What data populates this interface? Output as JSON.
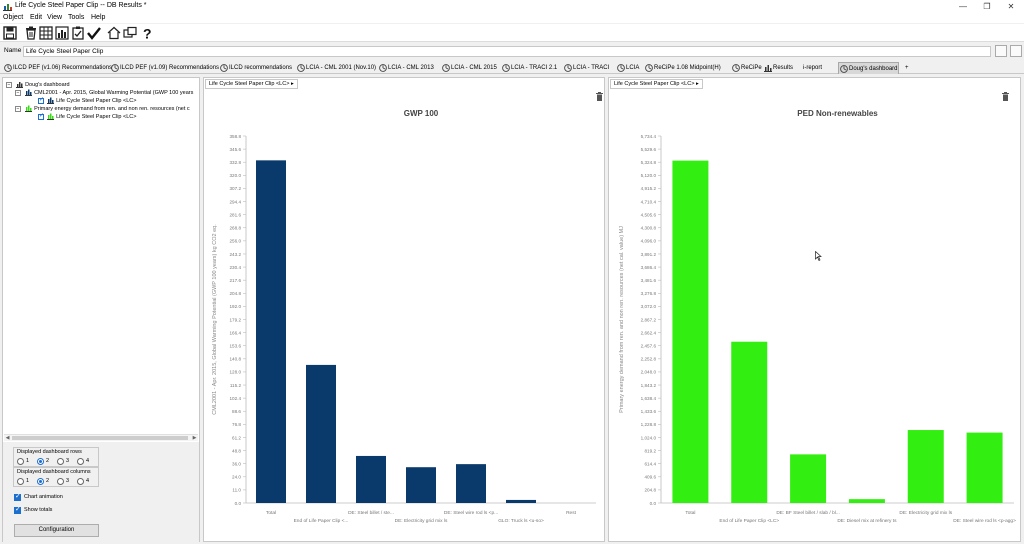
{
  "window": {
    "title": "Life Cycle Steel Paper Clip -- DB Results *",
    "controls": [
      "—",
      "❐",
      "✕"
    ]
  },
  "menu": [
    "Object",
    "Edit",
    "View",
    "Tools",
    "Help"
  ],
  "toolbar": {
    "icons": [
      "save-icon",
      "delete-icon",
      "table-icon",
      "bar-chart-icon",
      "checklist-icon",
      "check-icon",
      "home-icon",
      "windows-icon",
      "help-icon"
    ]
  },
  "namebar": {
    "label": "Name",
    "value": "Life Cycle Steel Paper Clip"
  },
  "tabs": [
    {
      "label": "ILCD PEF (v1.06) Recommendations",
      "icon": "chart"
    },
    {
      "label": "ILCD PEF (v1.09) Recommendations",
      "icon": "chart"
    },
    {
      "label": "ILCD recommendations",
      "icon": "chart"
    },
    {
      "label": "LCIA - CML 2001 (Nov.10)",
      "icon": "chart"
    },
    {
      "label": "LCIA - CML 2013",
      "icon": "chart"
    },
    {
      "label": "LCIA - CML 2015",
      "icon": "chart"
    },
    {
      "label": "LCIA - TRACI 2.1",
      "icon": "chart"
    },
    {
      "label": "LCIA - TRACI",
      "icon": "chart"
    },
    {
      "label": "LCIA",
      "icon": "chart"
    },
    {
      "label": "ReCiPe 1.08 Midpoint(H)",
      "icon": "chart"
    },
    {
      "label": "ReCiPe",
      "icon": "chart"
    },
    {
      "label": "Results",
      "icon": "results"
    },
    {
      "label": "i-report",
      "icon": "none"
    },
    {
      "label": "Doug's dashboard",
      "icon": "dash"
    },
    {
      "label": "+",
      "icon": "none"
    }
  ],
  "tree": {
    "root": "Doug's dashboard",
    "items": [
      {
        "label": "CML2001 - Apr. 2015, Global Warming Potential (GWP 100 years",
        "child": "Life Cycle Steel Paper Clip <LC>",
        "color": "#0a3a6b"
      },
      {
        "label": "Primary energy demand from ren. and non ren. resources (net c",
        "child": "Life Cycle Steel Paper Clip <LC>",
        "color": "#33dd11"
      }
    ]
  },
  "settings": {
    "rows_label": "Displayed dashboard rows",
    "cols_label": "Displayed dashboard columns",
    "options": [
      "1",
      "2",
      "3",
      "4"
    ],
    "rows_selected": 2,
    "cols_selected": 2,
    "chart_animation": "Chart animation",
    "show_totals": "Show totals",
    "config_button": "Configuration"
  },
  "panels": [
    {
      "selector": "Life Cycle Steel Paper Clip <LC>"
    },
    {
      "selector": "Life Cycle Steel Paper Clip <LC>"
    }
  ],
  "colors": {
    "gwp_bar": "#0a3a6b",
    "ped_bar": "#33ee11"
  },
  "chart_data": [
    {
      "type": "bar",
      "title": "GWP 100",
      "ylabel": "CML2001 - Apr. 2015, Global Warming Potential (GWP 100 years) kg CO2 eq.",
      "xlabel": "",
      "ylim": [
        0,
        358.8
      ],
      "yticks": [
        0.0,
        11.0,
        24.0,
        36.0,
        48.8,
        61.2,
        76.8,
        88.6,
        102.4,
        115.2,
        128.0,
        140.8,
        153.6,
        166.4,
        179.2,
        192.0,
        204.8,
        217.6,
        230.4,
        243.2,
        256.0,
        268.8,
        281.6,
        294.4,
        307.2,
        320.0,
        332.8,
        345.6,
        358.8
      ],
      "categories": [
        "Total",
        "End of Life Paper Clip <...",
        "DE: Steel billet / ste...",
        "DE: Electricity grid mix ls",
        "DE: Steel wire rod ls <p...",
        "GLO: Truck ls <u-so>",
        "Rest"
      ],
      "values": [
        335,
        135,
        46,
        35,
        38,
        3,
        0
      ],
      "grid": false,
      "legend": "none"
    },
    {
      "type": "bar",
      "title": "PED Non-renewables",
      "ylabel": "Primary energy demand from ren. and non ren. resources (net cal. value) MJ",
      "xlabel": "",
      "ylim": [
        0,
        5734.4
      ],
      "yticks": [
        "0.0",
        "204.8",
        "409.6",
        "614.4",
        "819.2",
        "1,024.0",
        "1,228.8",
        "1,433.6",
        "1,638.4",
        "1,843.2",
        "2,048.0",
        "2,252.8",
        "2,457.6",
        "2,662.4",
        "2,867.2",
        "3,072.0",
        "3,276.8",
        "3,481.6",
        "3,686.4",
        "3,891.2",
        "4,096.0",
        "4,300.8",
        "4,505.6",
        "4,710.4",
        "4,915.2",
        "5,120.0",
        "5,324.8",
        "5,529.6",
        "5,734.4"
      ],
      "categories": [
        "Total",
        "End of Life Paper Clip <LC>",
        "DE: BF Steel billet / slab / bl...",
        "DE: Diesel mix at refinery ts",
        "DE: Electricity grid mix ls",
        "DE: Steel wire rod ls <p-agg>"
      ],
      "values": [
        5350,
        2520,
        760,
        60,
        1140,
        1100
      ],
      "grid": false,
      "legend": "none"
    }
  ]
}
